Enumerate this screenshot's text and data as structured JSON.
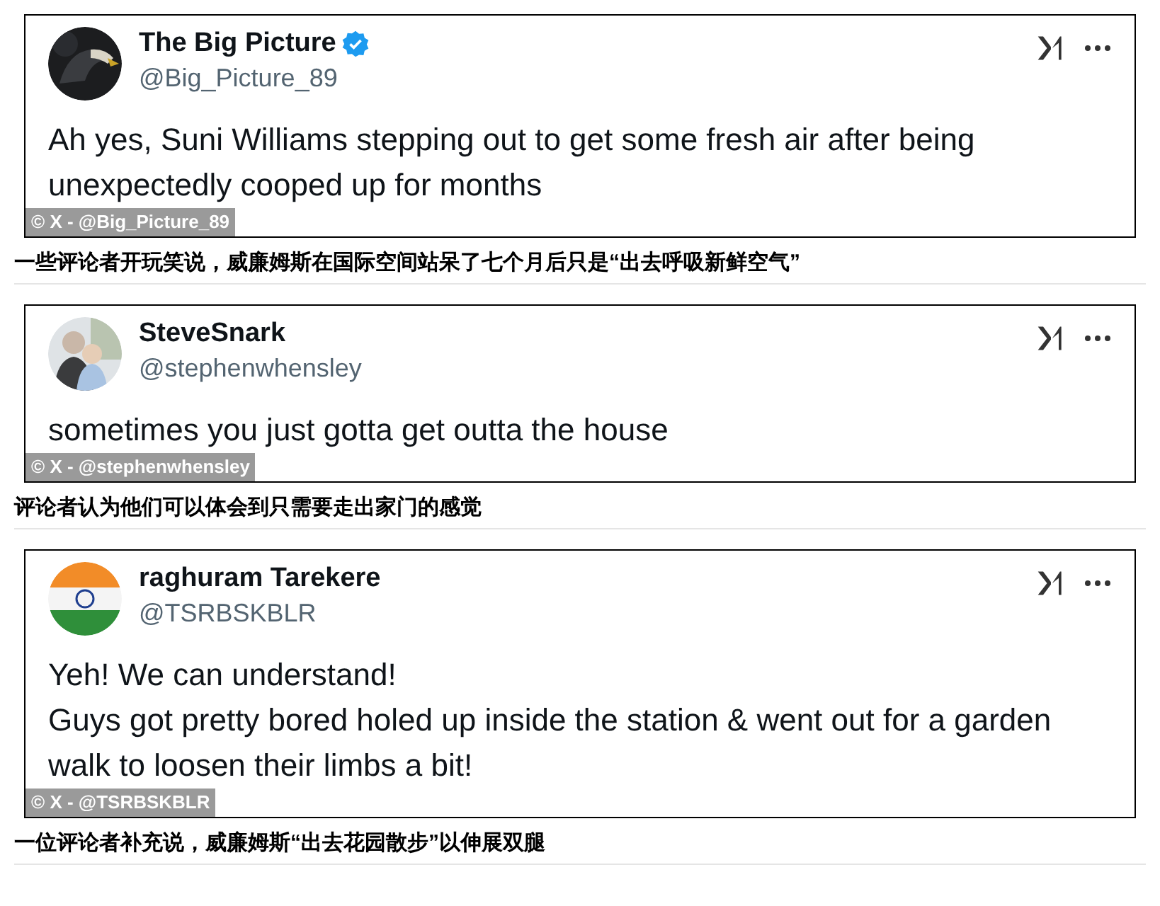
{
  "posts": [
    {
      "avatar": {
        "kind": "picture"
      },
      "name": "The Big Picture",
      "verified": true,
      "handle": "@Big_Picture_89",
      "body": [
        "Ah yes, Suni Williams stepping out to get some fresh air after being unexpectedly cooped up for months"
      ],
      "credit": "© X - @Big_Picture_89",
      "caption": "一些评论者开玩笑说，威廉姆斯在国际空间站呆了七个月后只是“出去呼吸新鲜空气”"
    },
    {
      "avatar": {
        "kind": "picture"
      },
      "name": "SteveSnark",
      "verified": false,
      "handle": "@stephenwhensley",
      "body": [
        "sometimes you just gotta get outta the house"
      ],
      "credit": "© X - @stephenwhensley",
      "caption": "评论者认为他们可以体会到只需要走出家门的感觉"
    },
    {
      "avatar": {
        "kind": "picture"
      },
      "name": "raghuram Tarekere",
      "verified": false,
      "handle": "@TSRBSKBLR",
      "body": [
        "Yeh! We can understand!",
        "Guys got pretty bored holed up inside the station & went out for a garden walk to loosen their limbs a bit!"
      ],
      "credit": "© X - @TSRBSKBLR",
      "caption": "一位评论者补充说，威廉姆斯“出去花园散步”以伸展双腿"
    }
  ]
}
